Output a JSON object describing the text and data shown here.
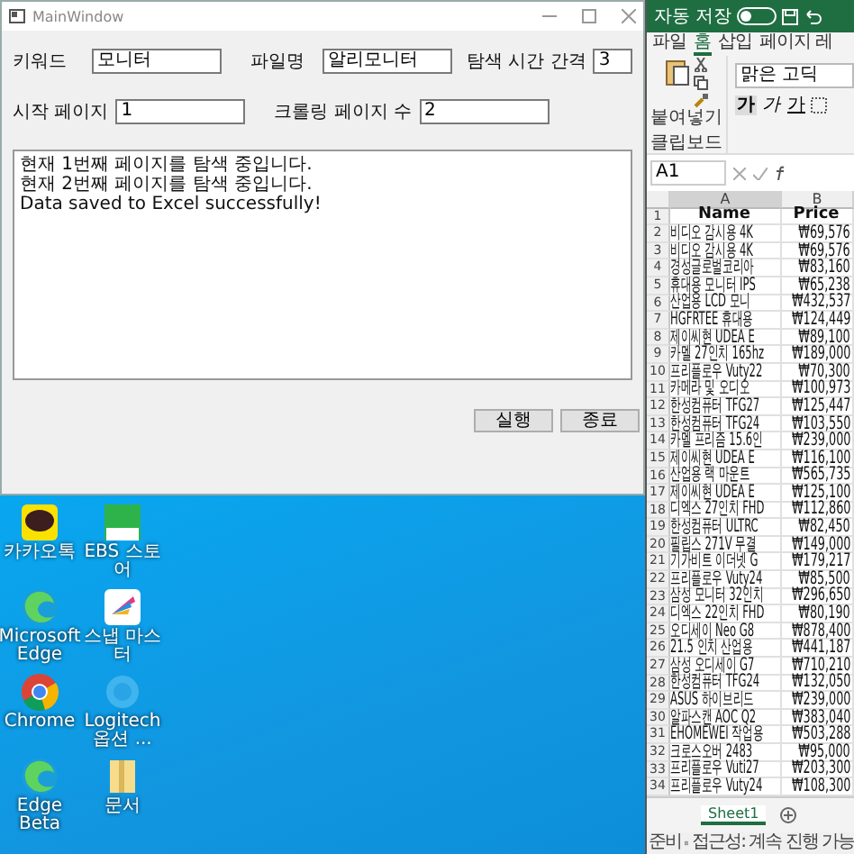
{
  "main_window": {
    "title": "MainWindow",
    "form_rows": [
      [
        {
          "label": "키워드",
          "value": "모니터"
        },
        {
          "label": "파일명",
          "value": "알리모니터"
        },
        {
          "label": "탐색 시간 간격",
          "value": "3"
        }
      ],
      [
        {
          "label": "시작 페이지",
          "value": "1"
        },
        {
          "label": "크롤링 페이지 수",
          "value": "2"
        }
      ]
    ],
    "log": [
      "현재 1번째 페이지를 탐색 중입니다.",
      "현재 2번째 페이지를 탐색 중입니다.",
      "Data saved to Excel successfully!"
    ],
    "buttons": [
      "실행",
      "종료"
    ]
  },
  "desktop": {
    "icons": [
      {
        "label": "카카오톡",
        "kind": "talk"
      },
      {
        "label": "EBS 스토어",
        "kind": "green"
      },
      {
        "label": "Microsoft Edge",
        "kind": "edge"
      },
      {
        "label": "스냅 마스터",
        "kind": "fan"
      },
      {
        "label": "Chrome",
        "kind": "chrome"
      },
      {
        "label": "Logitech 옵션 ...",
        "kind": "faded"
      },
      {
        "label": "Edge Beta",
        "kind": "edge"
      },
      {
        "label": "문서",
        "kind": "folder"
      }
    ]
  },
  "excel": {
    "autosave": {
      "label": "자동 저장",
      "on": false
    },
    "tabs": [
      {
        "label": "파일",
        "selected": false
      },
      {
        "label": "홈",
        "selected": true
      },
      {
        "label": "삽입",
        "selected": false
      },
      {
        "label": "페이지 레",
        "selected": false
      }
    ],
    "paste_label": "붙여넣기",
    "font_name": "맑은 고딕",
    "font_buttons": [
      "가",
      "가",
      "가"
    ],
    "group_label": "클립보드",
    "name_box": "A1",
    "columns": [
      "A",
      "B"
    ],
    "rows": [
      {
        "number": "1",
        "cells": [
          "Name",
          "Price"
        ]
      },
      {
        "number": "2",
        "cells": [
          "비디오 감시용 4K",
          "₩69,576"
        ]
      },
      {
        "number": "3",
        "cells": [
          "비디오 감시용 4K",
          "₩69,576"
        ]
      },
      {
        "number": "4",
        "cells": [
          "경성글로벌코리아",
          "₩83,160"
        ]
      },
      {
        "number": "5",
        "cells": [
          "휴대용 모니터 IPS",
          "₩65,238"
        ]
      },
      {
        "number": "6",
        "cells": [
          "산업용 LCD 모니",
          "₩432,537"
        ]
      },
      {
        "number": "7",
        "cells": [
          "HGFRTEE 휴대용",
          "₩124,449"
        ]
      },
      {
        "number": "8",
        "cells": [
          "제이씨현 UDEA E",
          "₩89,100"
        ]
      },
      {
        "number": "9",
        "cells": [
          "카멜 27인치 165hz",
          "₩189,000"
        ]
      },
      {
        "number": "10",
        "cells": [
          "프리플로우 Vuty22",
          "₩70,300"
        ]
      },
      {
        "number": "11",
        "cells": [
          "카메라 및 오디오",
          "₩100,973"
        ]
      },
      {
        "number": "12",
        "cells": [
          "한성컴퓨터 TFG27",
          "₩125,447"
        ]
      },
      {
        "number": "13",
        "cells": [
          "한성컴퓨터 TFG24",
          "₩103,550"
        ]
      },
      {
        "number": "14",
        "cells": [
          "카멜 프리즘 15.6인",
          "₩239,000"
        ]
      },
      {
        "number": "15",
        "cells": [
          "제이씨현 UDEA E",
          "₩116,100"
        ]
      },
      {
        "number": "16",
        "cells": [
          "산업용 랙 마운트",
          "₩565,735"
        ]
      },
      {
        "number": "17",
        "cells": [
          "제이씨현 UDEA E",
          "₩125,100"
        ]
      },
      {
        "number": "18",
        "cells": [
          "디엑스 27인치 FHD",
          "₩112,860"
        ]
      },
      {
        "number": "19",
        "cells": [
          "한성컴퓨터 ULTRC",
          "₩82,450"
        ]
      },
      {
        "number": "20",
        "cells": [
          "필립스 271V 무결",
          "₩149,000"
        ]
      },
      {
        "number": "21",
        "cells": [
          "기가비트 이더넷 G",
          "₩179,217"
        ]
      },
      {
        "number": "22",
        "cells": [
          "프리플로우 Vuty24",
          "₩85,500"
        ]
      },
      {
        "number": "23",
        "cells": [
          "삼성 모니터 32인치",
          "₩296,650"
        ]
      },
      {
        "number": "24",
        "cells": [
          "디엑스 22인치 FHD",
          "₩80,190"
        ]
      },
      {
        "number": "25",
        "cells": [
          "오디세이 Neo G8",
          "₩878,400"
        ]
      },
      {
        "number": "26",
        "cells": [
          "21.5 인치 산업용",
          "₩441,187"
        ]
      },
      {
        "number": "27",
        "cells": [
          "삼성 오디세이 G7",
          "₩710,210"
        ]
      },
      {
        "number": "28",
        "cells": [
          "한성컴퓨터 TFG24",
          "₩132,050"
        ]
      },
      {
        "number": "29",
        "cells": [
          "ASUS 하이브리드",
          "₩239,000"
        ]
      },
      {
        "number": "30",
        "cells": [
          "알파스캔 AOC Q2",
          "₩383,040"
        ]
      },
      {
        "number": "31",
        "cells": [
          "EHOMEWEI 작업용",
          "₩503,288"
        ]
      },
      {
        "number": "32",
        "cells": [
          "크로스오버 2483",
          "₩95,000"
        ]
      },
      {
        "number": "33",
        "cells": [
          "프리플로우 Vuti27",
          "₩203,300"
        ]
      },
      {
        "number": "34",
        "cells": [
          "프리플로우 Vuty24",
          "₩108,300"
        ]
      }
    ],
    "sheet_tab": "Sheet1",
    "status": [
      "준비",
      "접근성: 계속 진행 가능"
    ]
  }
}
